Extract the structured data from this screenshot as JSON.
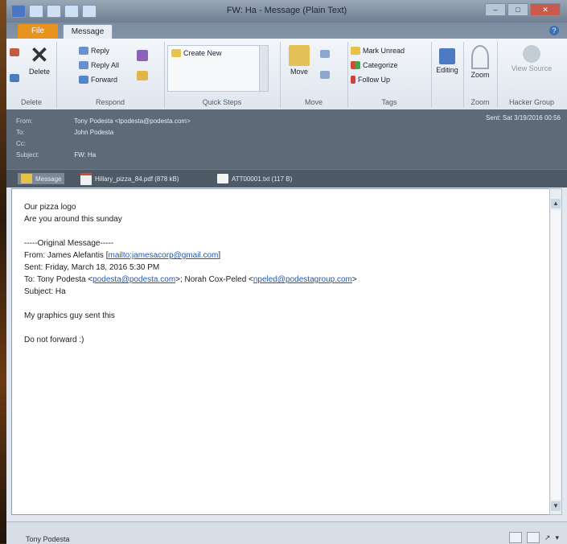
{
  "window": {
    "title": "FW: Ha - Message (Plain Text)"
  },
  "tabs": {
    "file": "File",
    "message": "Message"
  },
  "ribbon": {
    "delete": {
      "delete_label": "Delete",
      "group": "Delete"
    },
    "respond": {
      "reply": "Reply",
      "reply_all": "Reply All",
      "forward": "Forward",
      "group": "Respond"
    },
    "quick_steps": {
      "create_new": "Create New",
      "group": "Quick Steps"
    },
    "move": {
      "move": "Move",
      "group": "Move"
    },
    "tags": {
      "mark_unread": "Mark Unread",
      "categorize": "Categorize",
      "follow_up": "Follow Up",
      "group": "Tags"
    },
    "editing": {
      "label": "Editing"
    },
    "zoom": {
      "label": "Zoom",
      "group": "Zoom"
    },
    "viewsource": {
      "label": "View Source",
      "group": "Hacker Group"
    }
  },
  "header": {
    "from_label": "From:",
    "from_value": "Tony Podesta <tpodesta@podesta.com>",
    "to_label": "To:",
    "to_value": "John Podesta",
    "cc_label": "Cc:",
    "subject_label": "Subject:",
    "subject_value": "FW: Ha",
    "sent": "Sent: Sat 3/19/2016 00:56"
  },
  "attachments": [
    {
      "name": "Message"
    },
    {
      "name": "Hillary_pizza_84.pdf (878 kB)"
    },
    {
      "name": "ATT00001.txt (117 B)"
    }
  ],
  "body": {
    "l1": "Our pizza logo",
    "l2": "Are you around this sunday",
    "orig": "-----Original Message-----",
    "from_prefix": "From: James Alefantis [",
    "from_link": "mailto:jamesacorp@gmail.com",
    "from_suffix": "]",
    "sent": "Sent: Friday, March 18, 2016 5:30 PM",
    "to_prefix": "To: Tony Podesta <",
    "to_link1": "podesta@podesta.com",
    "to_mid": ">; Norah Cox-Peled <",
    "to_link2": "npeled@podestagroup.com",
    "to_suffix": ">",
    "subject": "Subject: Ha",
    "l3": "My graphics guy sent this",
    "l4": "Do not forward :)"
  },
  "statusbar": {
    "person": "Tony Podesta"
  },
  "colors": {
    "file_tab": "#e8931f",
    "link": "#1f59b6",
    "header_bg": "#5e6a78"
  }
}
